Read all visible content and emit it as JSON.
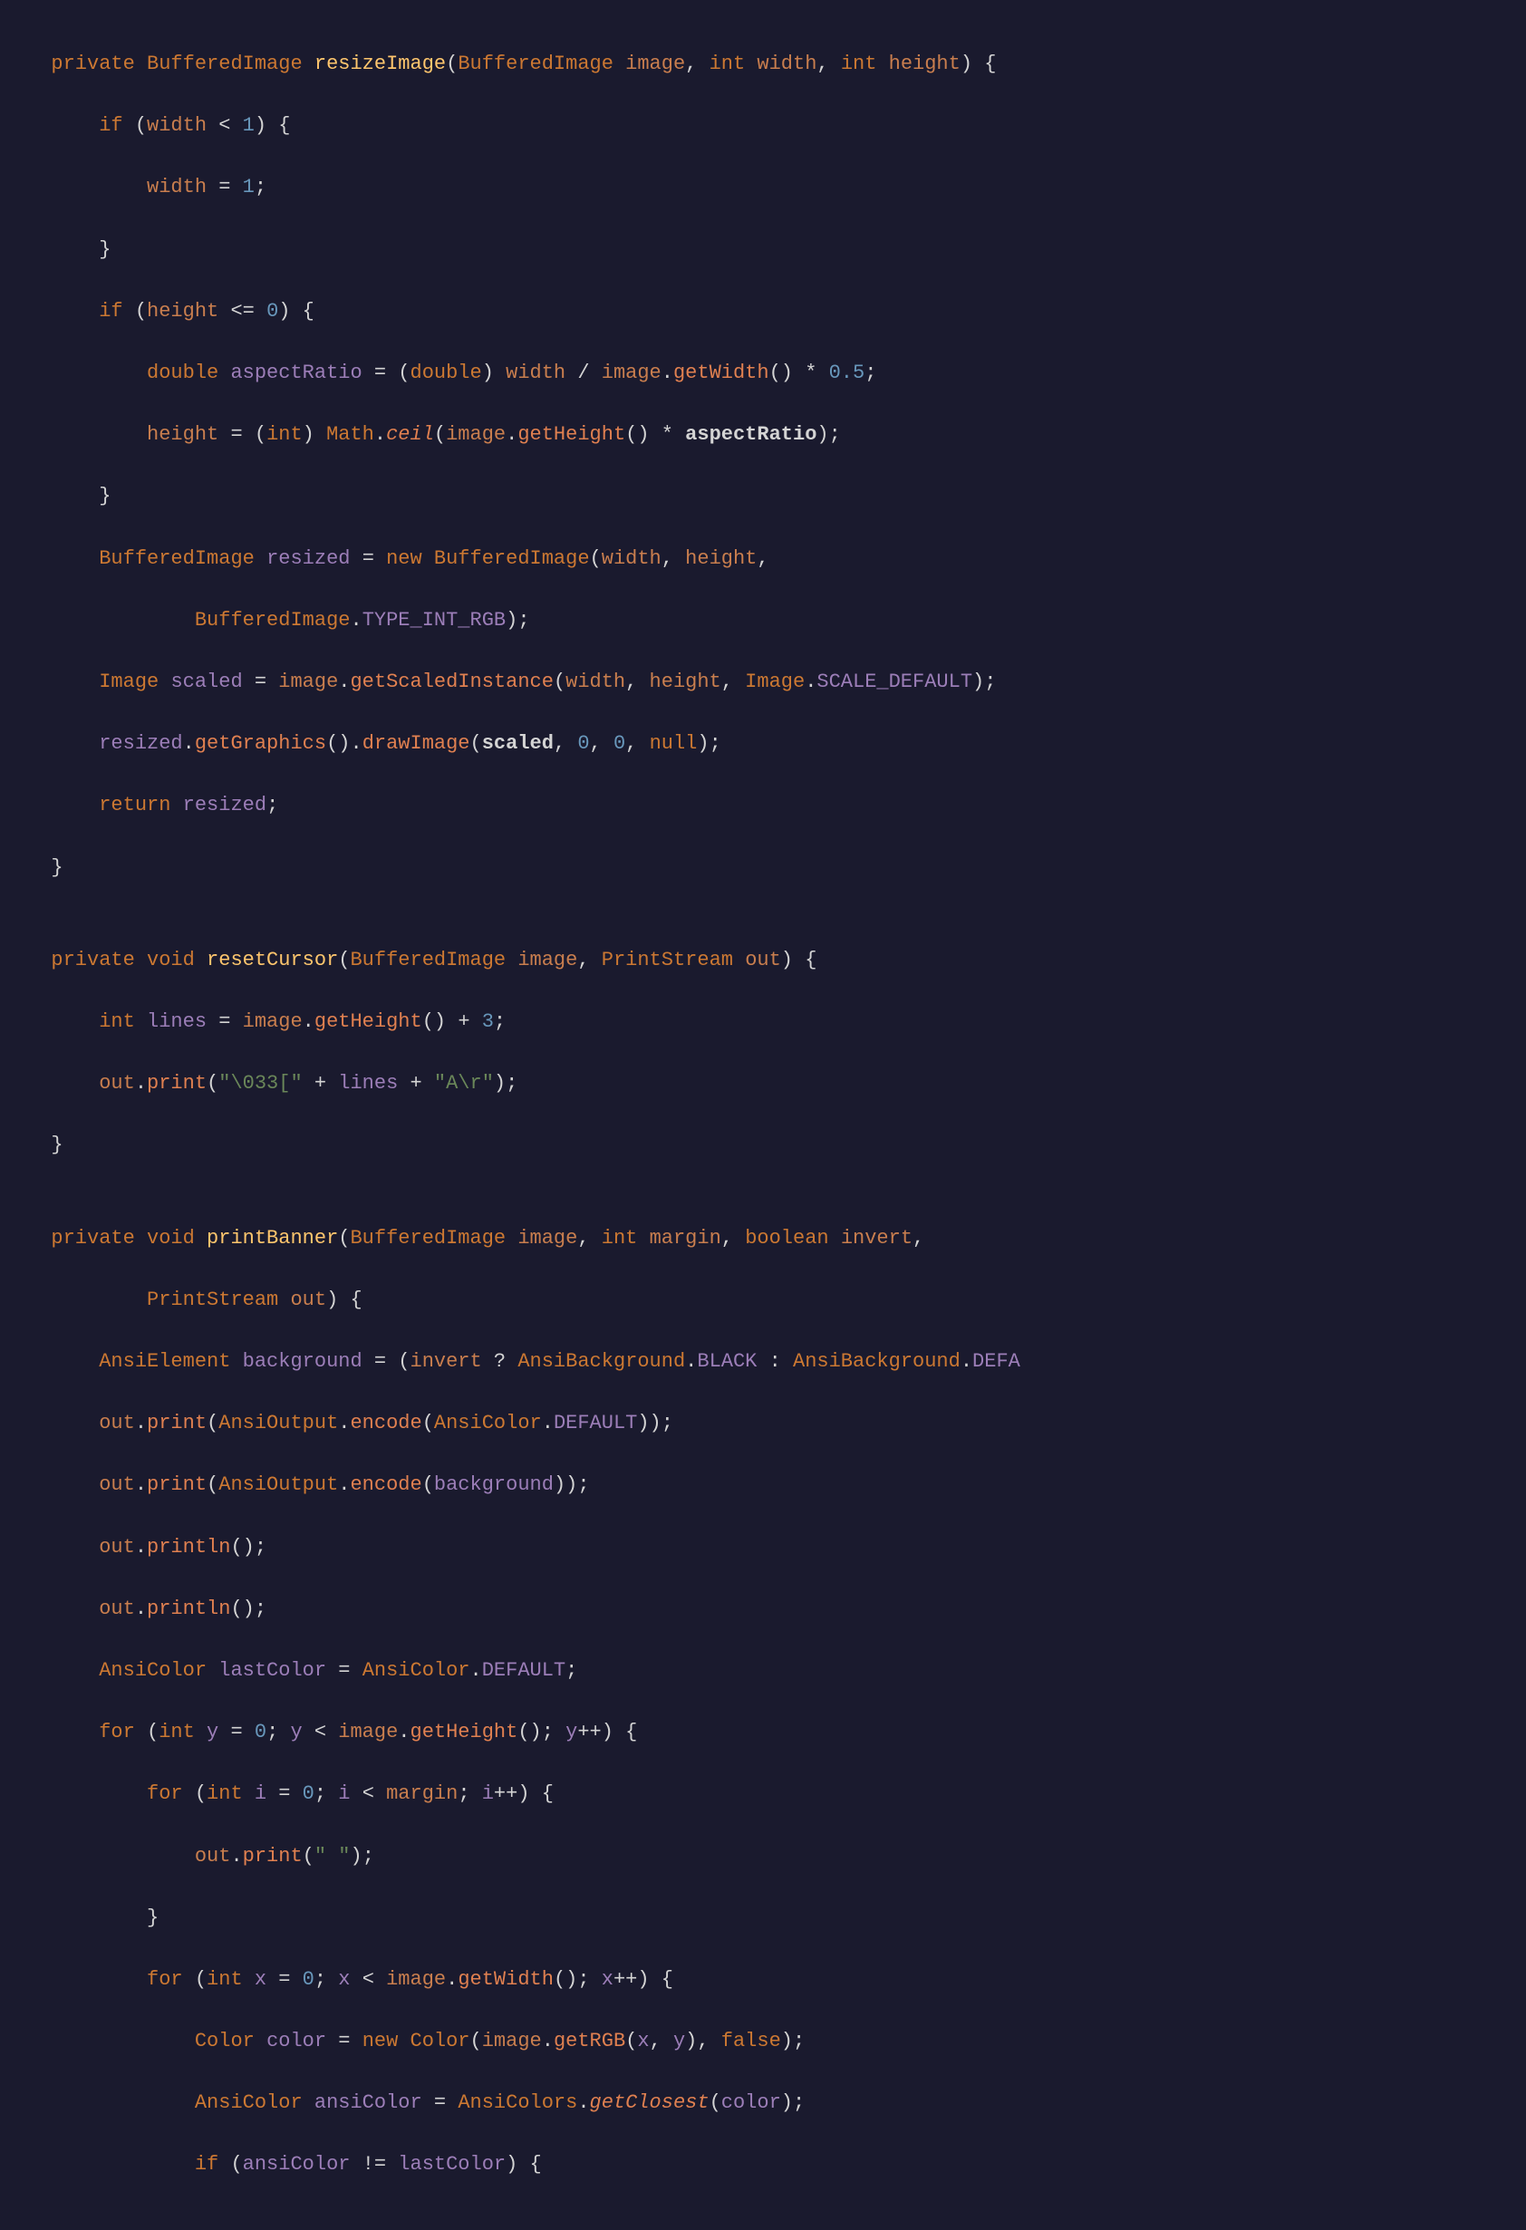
{
  "editor": {
    "background": "#1a1a2e",
    "language": "java",
    "content": "Java source code - image processing utility"
  }
}
